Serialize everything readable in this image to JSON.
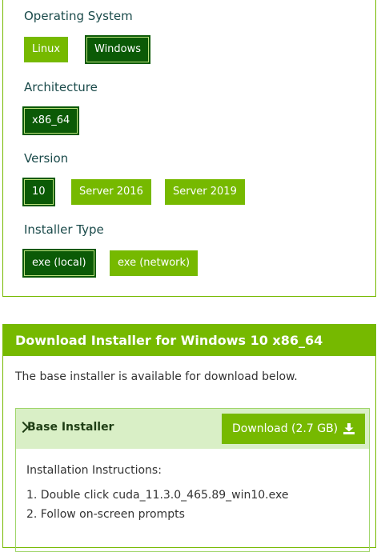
{
  "selector": {
    "operating_system": {
      "title": "Operating System",
      "options": [
        "Linux",
        "Windows"
      ]
    },
    "architecture": {
      "title": "Architecture",
      "options": [
        "x86_64"
      ]
    },
    "version": {
      "title": "Version",
      "options": [
        "10",
        "Server 2016",
        "Server 2019"
      ]
    },
    "installer_type": {
      "title": "Installer Type",
      "options": [
        "exe (local)",
        "exe (network)"
      ]
    }
  },
  "download": {
    "header": "Download Installer for Windows 10 x86_64",
    "description": "The base installer is available for download below.",
    "base_installer": {
      "title": "Base Installer",
      "download_label": "Download (2.7 GB)",
      "instructions_title": "Installation Instructions:",
      "steps": [
        "1. Double click cuda_11.3.0_465.89_win10.exe",
        "2. Follow on-screen prompts"
      ]
    }
  },
  "colors": {
    "accent": "#76b900",
    "selected": "#0b5a06",
    "panel_tint": "#d9efc6"
  }
}
